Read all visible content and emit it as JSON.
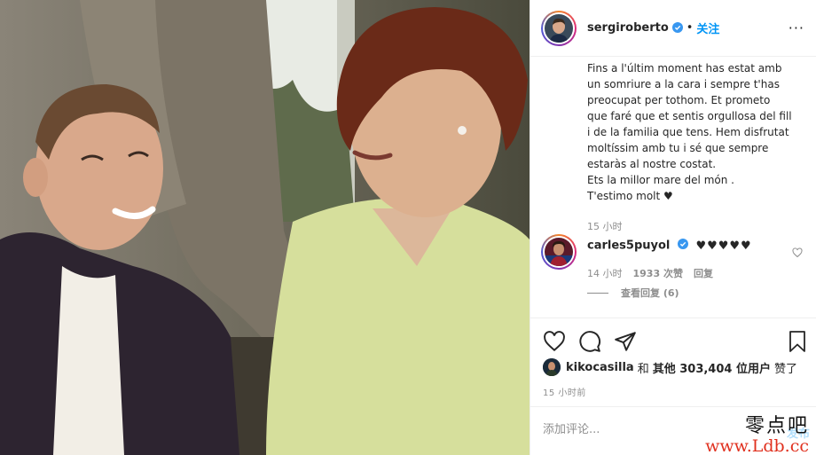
{
  "post": {
    "username": "sergiroberto",
    "separator": "•",
    "follow_label": "关注",
    "more_label": "···"
  },
  "caption": {
    "text": "Fins a l'últim moment has estat amb\nun somriure a la cara i sempre t'has\npreocupat per tothom. Et prometo\nque faré que et sentis orgullosa del fill\ni de la familia que tens. Hem disfrutat\nmoltíssim amb tu i sé que sempre\nestaràs al nostre costat.\nEts la millor mare del món .\nT'estimo molt ♥",
    "time": "15 小时"
  },
  "comment": {
    "username": "carles5puyol",
    "text": "♥♥♥♥♥",
    "time": "14 小时",
    "likes": "1933 次赞",
    "reply_label": "回复",
    "view_replies": "查看回复 (6)"
  },
  "icons": {
    "like": "heart-icon",
    "comment": "comment-icon",
    "share": "share-icon",
    "save": "bookmark-icon",
    "verified": "verified-badge-icon"
  },
  "likes": {
    "user": "kikocasilla",
    "connector": "和",
    "others": "其他 303,404 位用户",
    "suffix": "赞了"
  },
  "post_time": "15 小时前",
  "comment_box": {
    "placeholder": "添加评论...",
    "post_label": "发布"
  },
  "watermark": {
    "line1": "零点吧",
    "line2": "www.Ldb.cc"
  },
  "colors": {
    "accent": "#0095f6",
    "muted": "#8e8e8e",
    "text": "#262626",
    "border": "#efefef"
  }
}
